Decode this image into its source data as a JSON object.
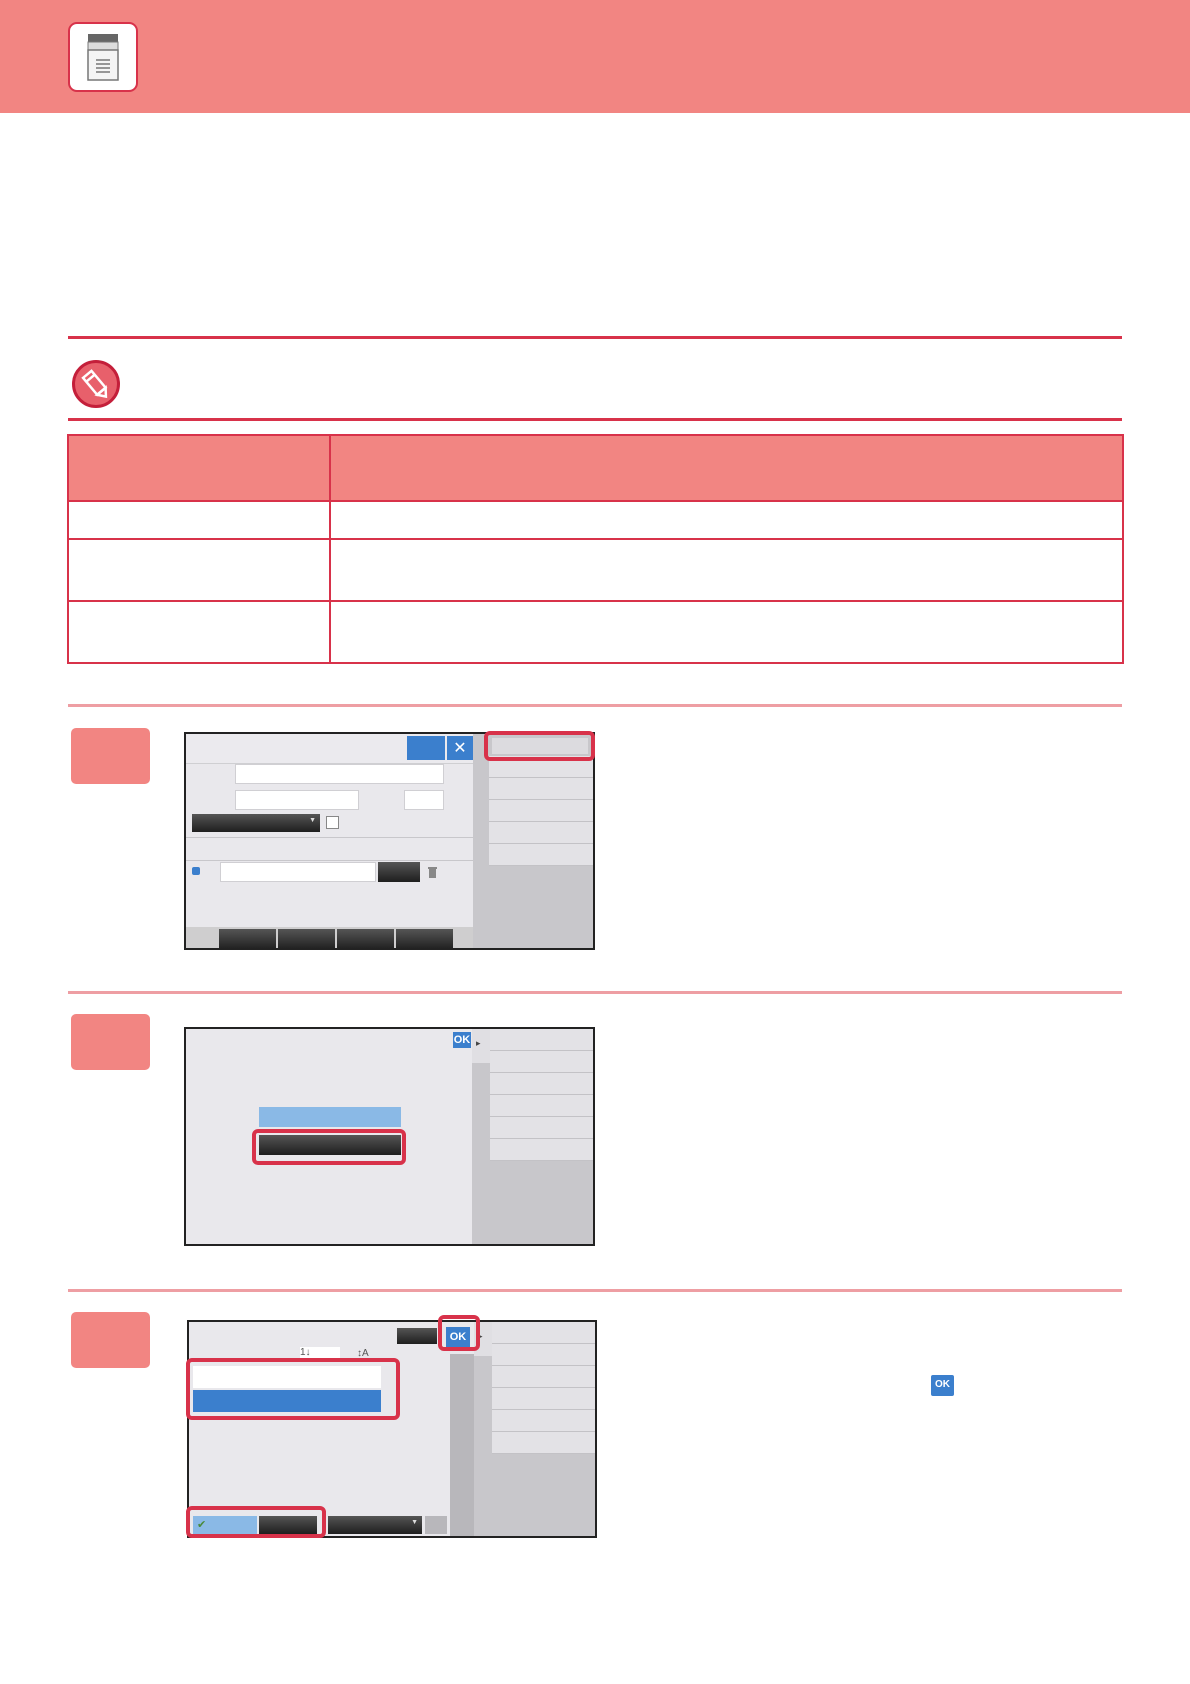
{
  "icons": {
    "home": "copier-home-icon",
    "note": "pencil-note-icon",
    "trash": "trash-icon",
    "close": "close-icon"
  },
  "colors": {
    "header": "#f28582",
    "accent": "#d8324a",
    "step_marker": "#f28582",
    "highlight": "#d8324a",
    "ui_blue": "#3b7fcd"
  },
  "screens": {
    "ok_label": "OK",
    "sort_number_label": "1↓",
    "sort_alpha_label": "↕A",
    "close_glyph": "✕"
  },
  "inline_ok_label": "OK"
}
